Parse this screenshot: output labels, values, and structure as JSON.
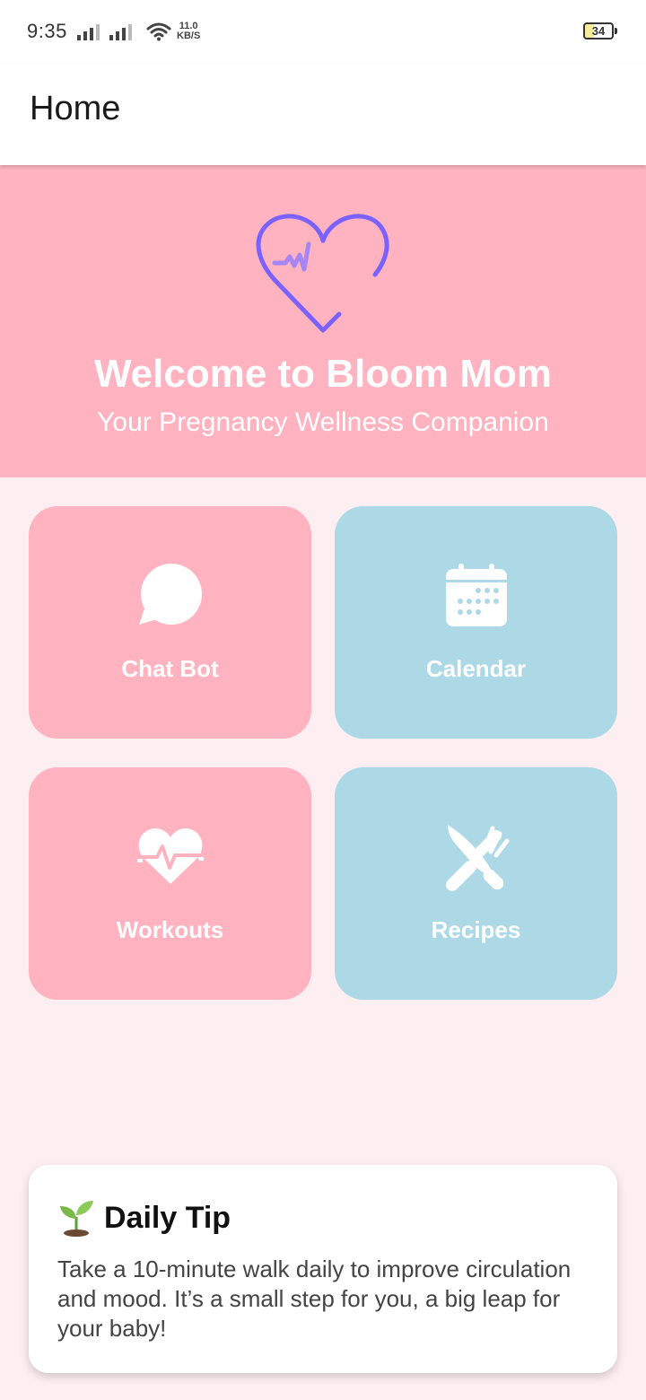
{
  "status_bar": {
    "time": "9:35",
    "net_speed_value": "11.0",
    "net_speed_unit": "KB/S",
    "battery": "34"
  },
  "app_bar": {
    "title": "Home"
  },
  "banner": {
    "icon": "heart-pulse-icon",
    "title": "Welcome to Bloom Mom",
    "subtitle": "Your Pregnancy Wellness Companion"
  },
  "tiles": [
    {
      "label": "Chat Bot",
      "icon": "chat-bubble-icon",
      "color": "#FFB3C0"
    },
    {
      "label": "Calendar",
      "icon": "calendar-icon",
      "color": "#ADD8E6"
    },
    {
      "label": "Workouts",
      "icon": "heart-pulse-icon",
      "color": "#FFB3C0"
    },
    {
      "label": "Recipes",
      "icon": "utensils-icon",
      "color": "#ADD8E6"
    }
  ],
  "daily_tip": {
    "icon": "seedling-icon",
    "title": "Daily Tip",
    "body": "Take a 10-minute walk daily to improve circulation and mood. It’s a small step for you, a big leap for your baby!"
  },
  "colors": {
    "pink": "#FFB3C0",
    "blue": "#ADD8E6",
    "background": "#FDEEF2",
    "accent_purple": "#7B61FF"
  }
}
